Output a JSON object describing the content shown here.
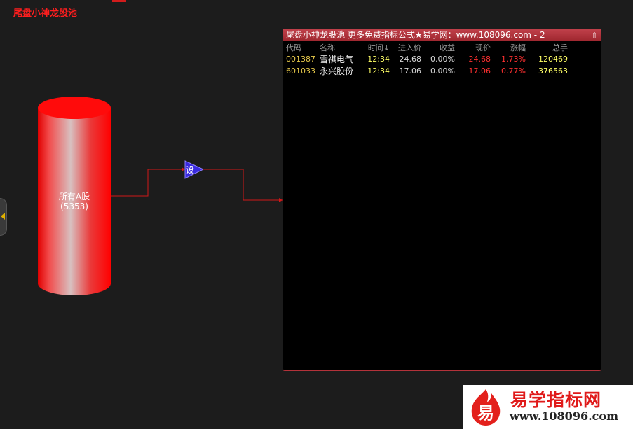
{
  "app": {
    "title": "尾盘小神龙股池"
  },
  "source": {
    "name": "所有A股",
    "count": "(5353)"
  },
  "filter": {
    "label": "设"
  },
  "panel": {
    "title": "尾盘小神龙股池  更多免费指标公式★易学网：www.108096.com - 2",
    "columns": [
      "代码",
      "名称",
      "时间↓",
      "进入价",
      "收益",
      "现价",
      "涨幅",
      "总手"
    ],
    "rows": [
      [
        "001387",
        "雪祺电气",
        "12:34",
        "24.68",
        "0.00%",
        "24.68",
        "1.73%",
        "120469"
      ],
      [
        "601033",
        "永兴股份",
        "12:34",
        "17.06",
        "0.00%",
        "17.06",
        "0.77%",
        "376563"
      ]
    ]
  },
  "brand": {
    "char": "易",
    "name": "易学指标网",
    "url": "www.108096.com"
  },
  "colors": {
    "accent": "#ff1e1e",
    "panel_border": "#b4323a",
    "wire": "#d01818",
    "filter_fill": "#3a2adf"
  }
}
